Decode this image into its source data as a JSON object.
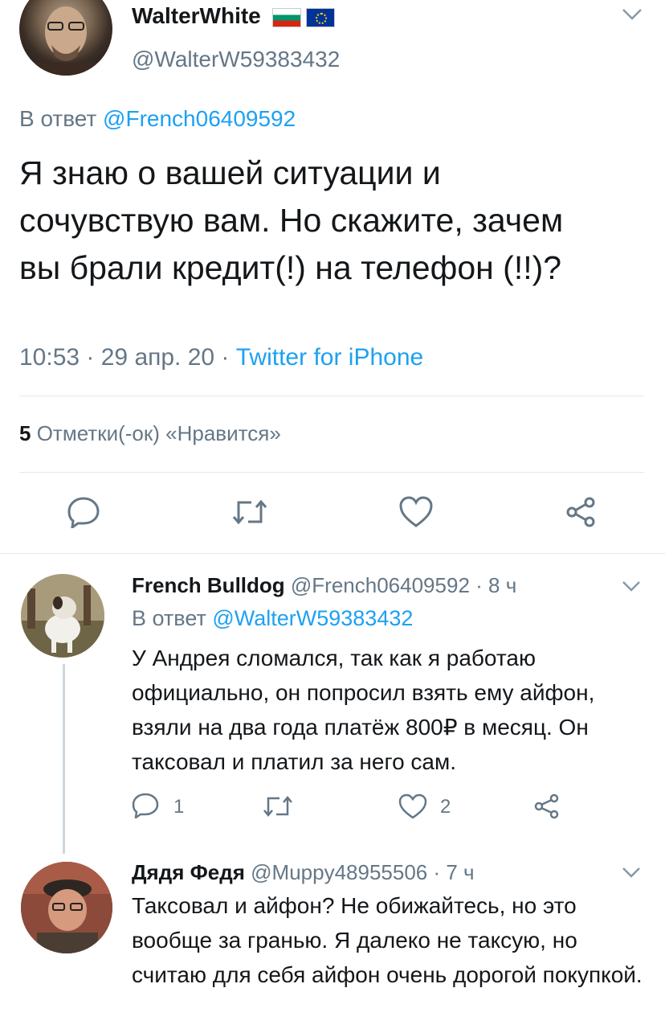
{
  "main_tweet": {
    "name": "WalterWhite",
    "handle": "@WalterW59383432",
    "reply_prefix": "В ответ",
    "reply_to": "@French06409592",
    "text": "Я знаю о вашей ситуации и сочувствую вам. Но скажите, зачем вы брали кредит(!) на телефон (!!)?",
    "time": "10:53 · 29 апр. 20 ·",
    "source": "Twitter for iPhone",
    "likes_count": "5",
    "likes_label": "Отметки(-ок) «Нравится»",
    "flags": [
      "bulgaria-flag",
      "eu-flag"
    ]
  },
  "replies": [
    {
      "name": "French Bulldog",
      "handle_time": "@French06409592 · 8 ч",
      "reply_prefix": "В ответ",
      "reply_to": "@WalterW59383432",
      "text": "У Андрея сломался, так как я работаю официально, он попросил взять ему айфон, взяли на два года платёж 800₽ в месяц. Он таксовал и платил за него сам.",
      "reply_count": "1",
      "like_count": "2"
    },
    {
      "name": "Дядя Федя",
      "handle_time": "@Muppy48955506 · 7 ч",
      "text": "Таксовал и айфон? Не обижайтесь, но это вообще за гранью. Я далеко не таксую, но считаю для себя айфон очень дорогой покупкой."
    }
  ],
  "colors": {
    "accent": "#1da1f2",
    "secondary_text": "#657786",
    "divider": "#e1e8ed"
  }
}
